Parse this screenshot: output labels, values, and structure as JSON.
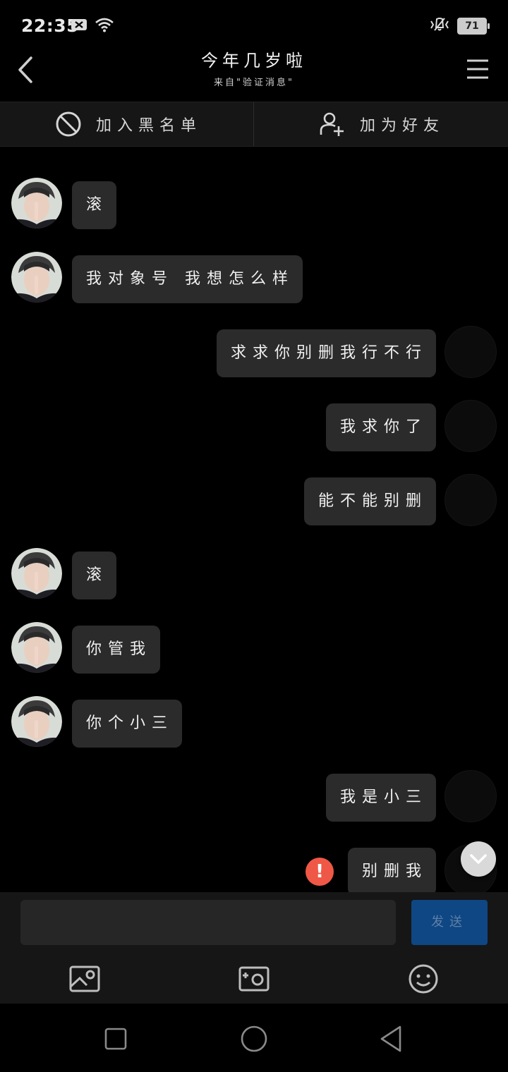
{
  "status_bar": {
    "time": "22:35",
    "battery": "71"
  },
  "header": {
    "title": "今年几岁啦",
    "subtitle": "来自\"验证消息\""
  },
  "actions": {
    "blacklist_label": "加入黑名单",
    "add_friend_label": "加为好友"
  },
  "messages": [
    {
      "side": "left",
      "text": "滚"
    },
    {
      "side": "left",
      "text": "我对象号 我想怎么样"
    },
    {
      "side": "right",
      "text": "求求你别删我行不行"
    },
    {
      "side": "right",
      "text": "我求你了"
    },
    {
      "side": "right",
      "text": "能不能别删"
    },
    {
      "side": "left",
      "text": "滚"
    },
    {
      "side": "left",
      "text": "你管我"
    },
    {
      "side": "left",
      "text": "你个小三"
    },
    {
      "side": "right",
      "text": "我是小三"
    },
    {
      "side": "right",
      "text": "别删我",
      "failed": true
    }
  ],
  "input": {
    "value": "",
    "placeholder": "",
    "send_label": "发送"
  },
  "toolbar": {
    "icons": [
      "image-icon",
      "camera-icon",
      "emoji-icon"
    ]
  },
  "nav": {
    "icons": [
      "recent-apps-icon",
      "home-icon",
      "back-icon"
    ]
  },
  "colors": {
    "bubble": "#2b2b2b",
    "send_button": "#0e4783",
    "error": "#ef5846"
  }
}
